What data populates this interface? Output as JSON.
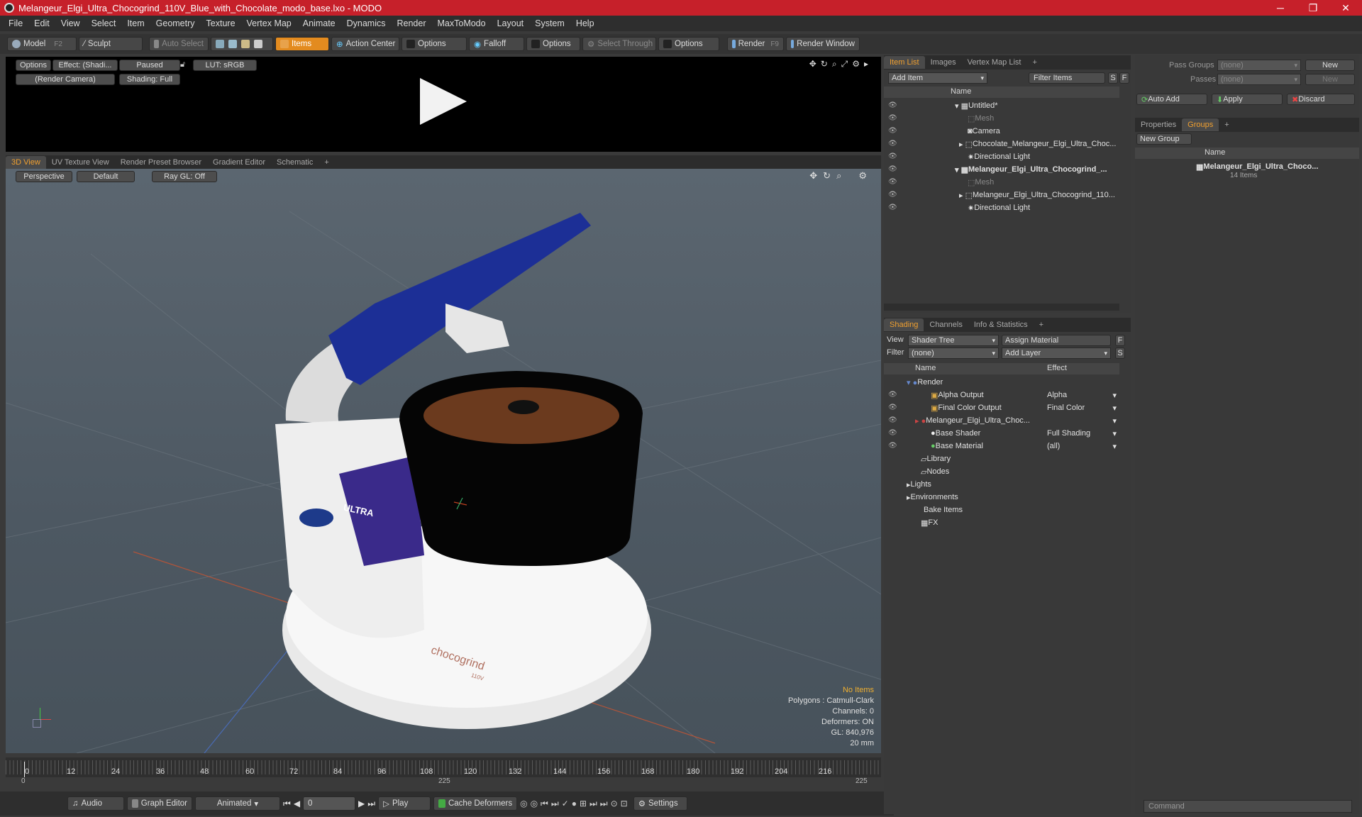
{
  "window": {
    "title": "Melangeur_Elgi_Ultra_Chocogrind_110V_Blue_with_Chocolate_modo_base.lxo - MODO",
    "min": "─",
    "max": "❐",
    "close": "✕"
  },
  "menu": [
    "File",
    "Edit",
    "View",
    "Select",
    "Item",
    "Geometry",
    "Texture",
    "Vertex Map",
    "Animate",
    "Dynamics",
    "Render",
    "MaxToModo",
    "Layout",
    "System",
    "Help"
  ],
  "toolbar": {
    "model": "Model",
    "model_key": "F2",
    "sculpt": "Sculpt",
    "auto_select": "Auto Select",
    "items": "Items",
    "action_center": "Action Center",
    "options1": "Options",
    "falloff": "Falloff",
    "options2": "Options",
    "select_through": "Select Through",
    "options3": "Options",
    "render": "Render",
    "render_key": "F9",
    "render_window": "Render Window"
  },
  "render_panel": {
    "options": "Options",
    "effect": "Effect: (Shadi...",
    "paused": "Paused",
    "lut": "LUT: sRGB",
    "camera": "(Render Camera)",
    "shading": "Shading: Full"
  },
  "view_tabs": [
    "3D View",
    "UV Texture View",
    "Render Preset Browser",
    "Gradient Editor",
    "Schematic",
    "+"
  ],
  "viewport": {
    "perspective": "Perspective",
    "default": "Default",
    "raygl": "Ray GL: Off",
    "product_brand": "ULTRA",
    "product_name": "chocogrind",
    "product_sub": "110V"
  },
  "stats": {
    "no_items": "No Items",
    "polygons": "Polygons : Catmull-Clark",
    "channels": "Channels: 0",
    "deformers": "Deformers: ON",
    "gl": "GL: 840,976",
    "unit": "20 mm"
  },
  "item_list": {
    "tabs": [
      "Item List",
      "Images",
      "Vertex Map List",
      "+"
    ],
    "add_item": "Add Item",
    "filter_items": "Filter Items",
    "s": "S",
    "f": "F",
    "name_header": "Name",
    "rows": [
      {
        "label": "Untitled*",
        "indent": 0,
        "bold": false
      },
      {
        "label": "Mesh",
        "indent": 1,
        "dim": true
      },
      {
        "label": "Camera",
        "indent": 1
      },
      {
        "label": "Chocolate_Melangeur_Elgi_Ultra_Choc...",
        "indent": 1
      },
      {
        "label": "Directional Light",
        "indent": 1
      },
      {
        "label": "Melangeur_Elgi_Ultra_Chocogrind_...",
        "indent": 0,
        "bold": true
      },
      {
        "label": "Mesh",
        "indent": 1,
        "dim": true
      },
      {
        "label": "Melangeur_Elgi_Ultra_Chocogrind_110...",
        "indent": 1
      },
      {
        "label": "Directional Light",
        "indent": 1
      }
    ]
  },
  "shading": {
    "tabs": [
      "Shading",
      "Channels",
      "Info & Statistics",
      "+"
    ],
    "view_label": "View",
    "view_value": "Shader Tree",
    "assign_material": "Assign Material",
    "filter_label": "Filter",
    "filter_value": "(none)",
    "add_layer": "Add Layer",
    "f": "F",
    "s": "S",
    "name_header": "Name",
    "effect_header": "Effect",
    "rows": [
      {
        "label": "Render",
        "effect": ""
      },
      {
        "label": "Alpha Output",
        "effect": "Alpha"
      },
      {
        "label": "Final Color Output",
        "effect": "Final Color"
      },
      {
        "label": "Melangeur_Elgi_Ultra_Choc...",
        "effect": ""
      },
      {
        "label": "Base Shader",
        "effect": "Full Shading"
      },
      {
        "label": "Base Material",
        "effect": "(all)"
      },
      {
        "label": "Library",
        "effect": ""
      },
      {
        "label": "Nodes",
        "effect": ""
      },
      {
        "label": "Lights",
        "effect": ""
      },
      {
        "label": "Environments",
        "effect": ""
      },
      {
        "label": "Bake Items",
        "effect": ""
      },
      {
        "label": "FX",
        "effect": ""
      }
    ]
  },
  "groups_panel": {
    "pass_groups": "Pass Groups",
    "passes": "Passes",
    "none1": "(none)",
    "none2": "(none)",
    "new1": "New",
    "new2": "New",
    "auto_add": "Auto Add",
    "apply": "Apply",
    "discard": "Discard",
    "tabs": [
      "Properties",
      "Groups",
      "+"
    ],
    "new_group": "New Group",
    "name_header": "Name",
    "group_name": "Melangeur_Elgi_Ultra_Choco...",
    "group_count": "14 Items",
    "command_placeholder": "Command"
  },
  "timeline": {
    "ticks": [
      "0",
      "12",
      "24",
      "36",
      "48",
      "60",
      "72",
      "84",
      "96",
      "108",
      "120",
      "132",
      "144",
      "156",
      "168",
      "180",
      "192",
      "204",
      "216"
    ],
    "start": "0",
    "mid": "225",
    "end": "225"
  },
  "bottom": {
    "audio": "Audio",
    "graph_editor": "Graph Editor",
    "animated": "Animated",
    "frame": "0",
    "play": "Play",
    "cache_deformers": "Cache Deformers",
    "settings": "Settings"
  }
}
